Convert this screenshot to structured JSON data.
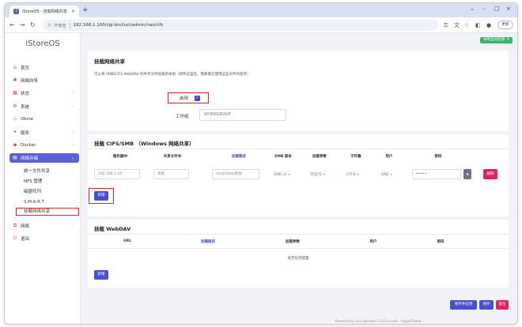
{
  "browser": {
    "tab_title": "iStoreOS - 挂载网络共享 - LuCI",
    "favicon": "i",
    "address_insecure": "不安全",
    "url": "192.168.1.100/cgi-bin/luci/admin/nas/cifs",
    "update_label": "更新"
  },
  "sidebar": {
    "brand": "iStoreOS",
    "items": [
      {
        "label": "首页",
        "icon": "home-icon"
      },
      {
        "label": "网络向导",
        "icon": "wizard-icon"
      },
      {
        "label": "状态",
        "icon": "status-icon"
      },
      {
        "label": "系统",
        "icon": "system-icon"
      },
      {
        "label": "iStore",
        "icon": "istore-icon"
      },
      {
        "label": "服务",
        "icon": "services-icon"
      },
      {
        "label": "Docker",
        "icon": "docker-icon"
      },
      {
        "label": "网络存储",
        "icon": "nas-icon"
      },
      {
        "label": "网络",
        "icon": "network-icon"
      },
      {
        "label": "退出",
        "icon": "logout-icon"
      }
    ],
    "sub_items": [
      "统一文件共享",
      "NFS 管理",
      "磁盘阵列",
      "S.M.A.R.T.",
      "挂载网络共享"
    ]
  },
  "header": {
    "badge": "本地自动检测: 6"
  },
  "share": {
    "title": "挂载网络共享",
    "description": "可以将 SMB/CIFS,WebDAV 的共享文件挂载到本地（修改这里后，需要重启使用这些文件的程序）",
    "enable_label": "启用",
    "enable_checked": "✓",
    "workgroup_label": "工作组",
    "workgroup_value": "WORKGROUP"
  },
  "cifs": {
    "title": "挂载 CIFS/SMB （Windows 网络共享）",
    "headers": [
      "服务器IP",
      "共享文件夹",
      "挂载路径",
      "SMB 版本",
      "挂载参数",
      "字符集",
      "用户",
      "密码"
    ],
    "row": {
      "server": "192.168.1.10",
      "share": "系统",
      "mount": "/mnt/data/系统",
      "smb_version": "SMB v2",
      "params": "可读/写",
      "charset": "UTF8",
      "user": "ONE",
      "password": "•••••",
      "delete_label": "删除"
    },
    "add_label": "新增"
  },
  "webdav": {
    "title": "挂载 WebDAV",
    "headers": [
      "URL",
      "挂载路径",
      "挂载参数",
      "用户",
      "密码"
    ],
    "empty_text": "尚无任何配置",
    "add_label": "新增"
  },
  "actions": {
    "save_apply": "保存并应用",
    "save": "保存",
    "reset": "复位"
  },
  "footer": "Powered by LuCI openwrt-21.02 branch · ArgonTheme"
}
